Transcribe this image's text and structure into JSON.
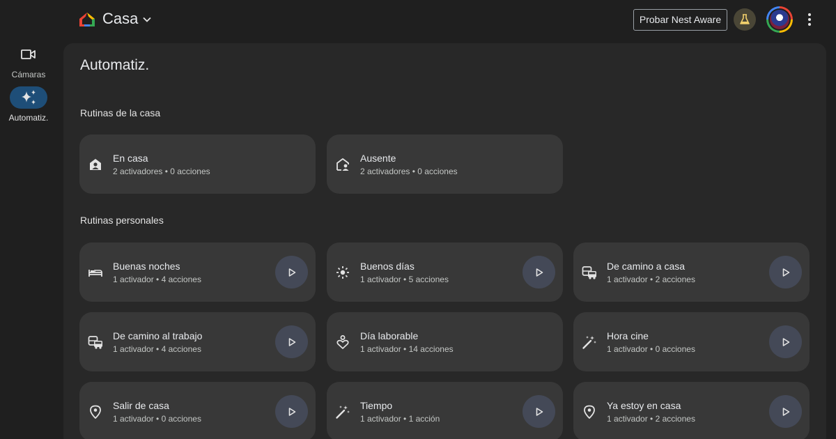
{
  "header": {
    "home_name": "Casa",
    "nest_button": "Probar Nest Aware",
    "icons": [
      "google-home-logo",
      "chevron-down-icon",
      "labs-flask-icon",
      "avatar",
      "more-vert-icon"
    ]
  },
  "sidebar": {
    "items": [
      {
        "label": "Cámaras",
        "icon": "camera-icon",
        "active": false
      },
      {
        "label": "Automatiz.",
        "icon": "sparkle-icon",
        "active": true
      }
    ]
  },
  "main": {
    "title": "Automatiz.",
    "household_section": "Rutinas de la casa",
    "personal_section": "Rutinas personales",
    "household_routines": [
      {
        "title": "En casa",
        "subtitle": "2 activadores • 0 acciones",
        "icon": "home-person-icon"
      },
      {
        "title": "Ausente",
        "subtitle": "2 activadores • 0 acciones",
        "icon": "away-person-icon"
      }
    ],
    "personal_routines": [
      {
        "title": "Buenas noches",
        "subtitle": "1 activador • 4 acciones",
        "icon": "bed-icon"
      },
      {
        "title": "Buenos días",
        "subtitle": "1 activador • 5 acciones",
        "icon": "sun-icon"
      },
      {
        "title": "De camino a casa",
        "subtitle": "1 activador • 2 acciones",
        "icon": "commute-icon"
      },
      {
        "title": "De camino al trabajo",
        "subtitle": "1 activador • 4 acciones",
        "icon": "commute-icon"
      },
      {
        "title": "Día laborable",
        "subtitle": "1 activador • 14 acciones",
        "icon": "self-care-icon"
      },
      {
        "title": "Hora cine",
        "subtitle": "1 activador • 0 acciones",
        "icon": "magic-wand-icon"
      },
      {
        "title": "Salir de casa",
        "subtitle": "1 activador • 0 acciones",
        "icon": "location-pin-icon"
      },
      {
        "title": "Tiempo",
        "subtitle": "1 activador • 1 acción",
        "icon": "magic-wand-icon"
      },
      {
        "title": "Ya estoy en casa",
        "subtitle": "1 activador • 2 acciones",
        "icon": "location-pin-icon"
      }
    ]
  },
  "colors": {
    "background": "#1f1f1f",
    "panel": "#282828",
    "card": "#383838",
    "play_button": "#444957",
    "active_nav": "#1e4e78",
    "labs_button": "#4a4636"
  }
}
